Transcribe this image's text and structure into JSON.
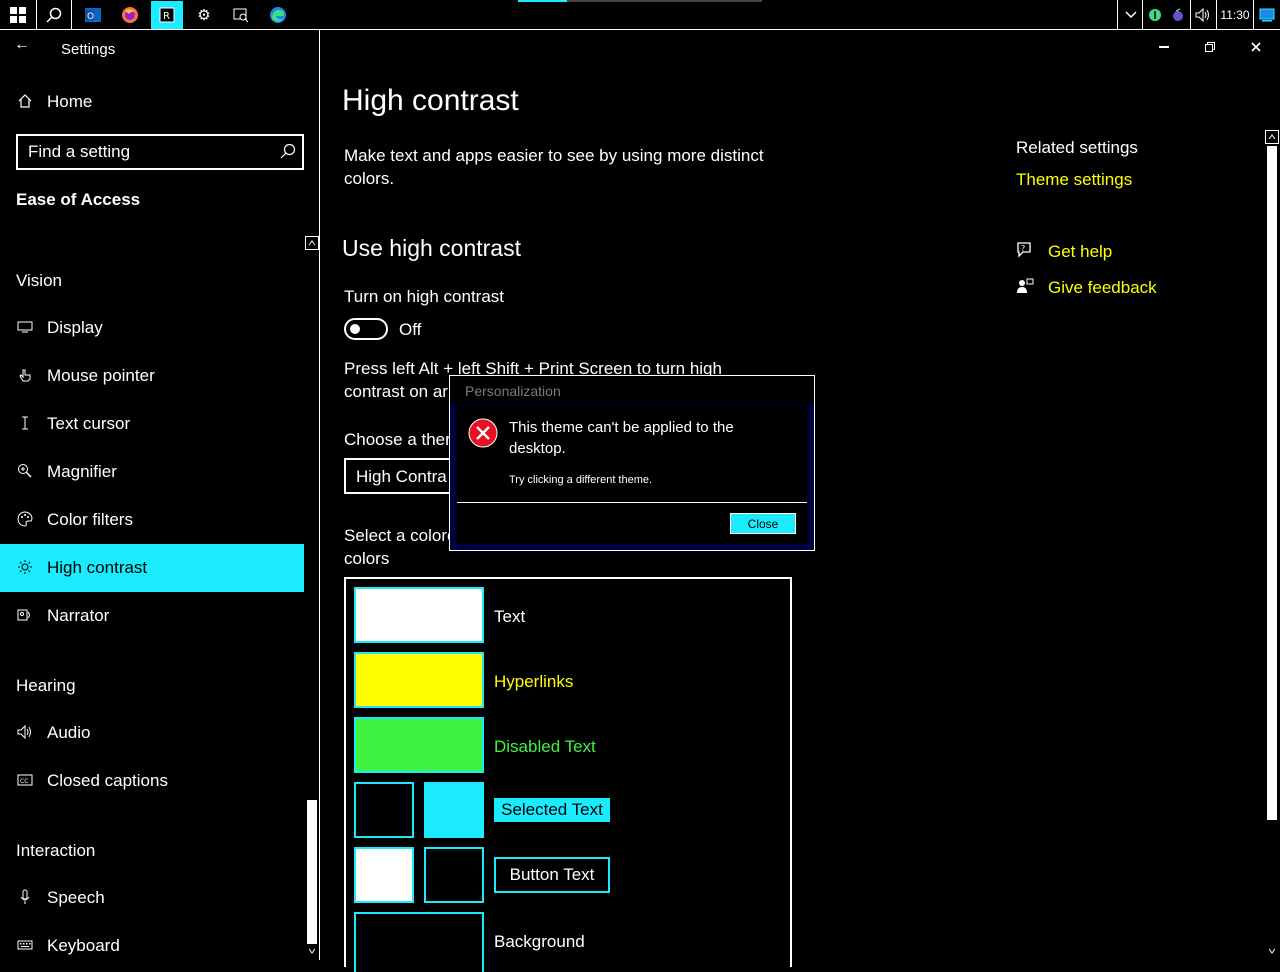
{
  "taskbar": {
    "start_icon": "windows-logo-icon",
    "search_icon": "search-icon",
    "apps": [
      {
        "name": "outlook-icon",
        "glyph": "O"
      },
      {
        "name": "firefox-icon",
        "glyph": "●"
      },
      {
        "name": "remote-app-icon",
        "glyph": "R"
      },
      {
        "name": "settings-gear-icon",
        "glyph": "⚙"
      },
      {
        "name": "search-app-icon",
        "glyph": "⌕"
      },
      {
        "name": "edge-icon",
        "glyph": "e"
      }
    ],
    "progress_fraction": 0.2,
    "tray": {
      "chevron": "⌄",
      "volume": "🔊",
      "time": "11:30"
    }
  },
  "window": {
    "title": "Settings",
    "back_glyph": "←",
    "minimize_glyph": "—",
    "restore_glyph": "❐",
    "close_glyph": "✕"
  },
  "sidebar": {
    "home_label": "Home",
    "search_placeholder": "Find a setting",
    "category": "Ease of Access",
    "groups": {
      "vision": "Vision",
      "hearing": "Hearing",
      "interaction": "Interaction"
    },
    "items": {
      "display": "Display",
      "mouse_pointer": "Mouse pointer",
      "text_cursor": "Text cursor",
      "magnifier": "Magnifier",
      "color_filters": "Color filters",
      "high_contrast": "High contrast",
      "narrator": "Narrator",
      "audio": "Audio",
      "closed_captions": "Closed captions",
      "speech": "Speech",
      "keyboard": "Keyboard"
    }
  },
  "main": {
    "page_title": "High contrast",
    "description_line1": "Make text and apps easier to see by using more distinct",
    "description_line2": "colors.",
    "section_title": "Use high contrast",
    "toggle_label": "Turn on high contrast",
    "toggle_state": "Off",
    "shortcut_line1": "Press left Alt + left Shift + Print Screen to turn high",
    "shortcut_line2": "contrast on ar",
    "theme_label": "Choose a ther",
    "theme_value": "High Contra",
    "select_color_line1": "Select a colore",
    "select_color_line2": "colors",
    "swatches": {
      "text": "Text",
      "hyperlinks": "Hyperlinks",
      "disabled_text": "Disabled Text",
      "selected_text": "Selected Text",
      "button_text": "Button Text",
      "background": "Background"
    },
    "colors": {
      "text": "#ffffff",
      "hyperlinks": "#ffff00",
      "disabled_text": "#3ff23f",
      "selected_bg": "#1aebff",
      "accent": "#1aebff"
    }
  },
  "related": {
    "title": "Related settings",
    "theme_settings": "Theme settings",
    "get_help": "Get help",
    "give_feedback": "Give feedback"
  },
  "dialog": {
    "title": "Personalization",
    "message_line1": "This theme can't be applied to the",
    "message_line2": "desktop.",
    "hint": "Try clicking a different theme.",
    "close_label": "Close"
  }
}
